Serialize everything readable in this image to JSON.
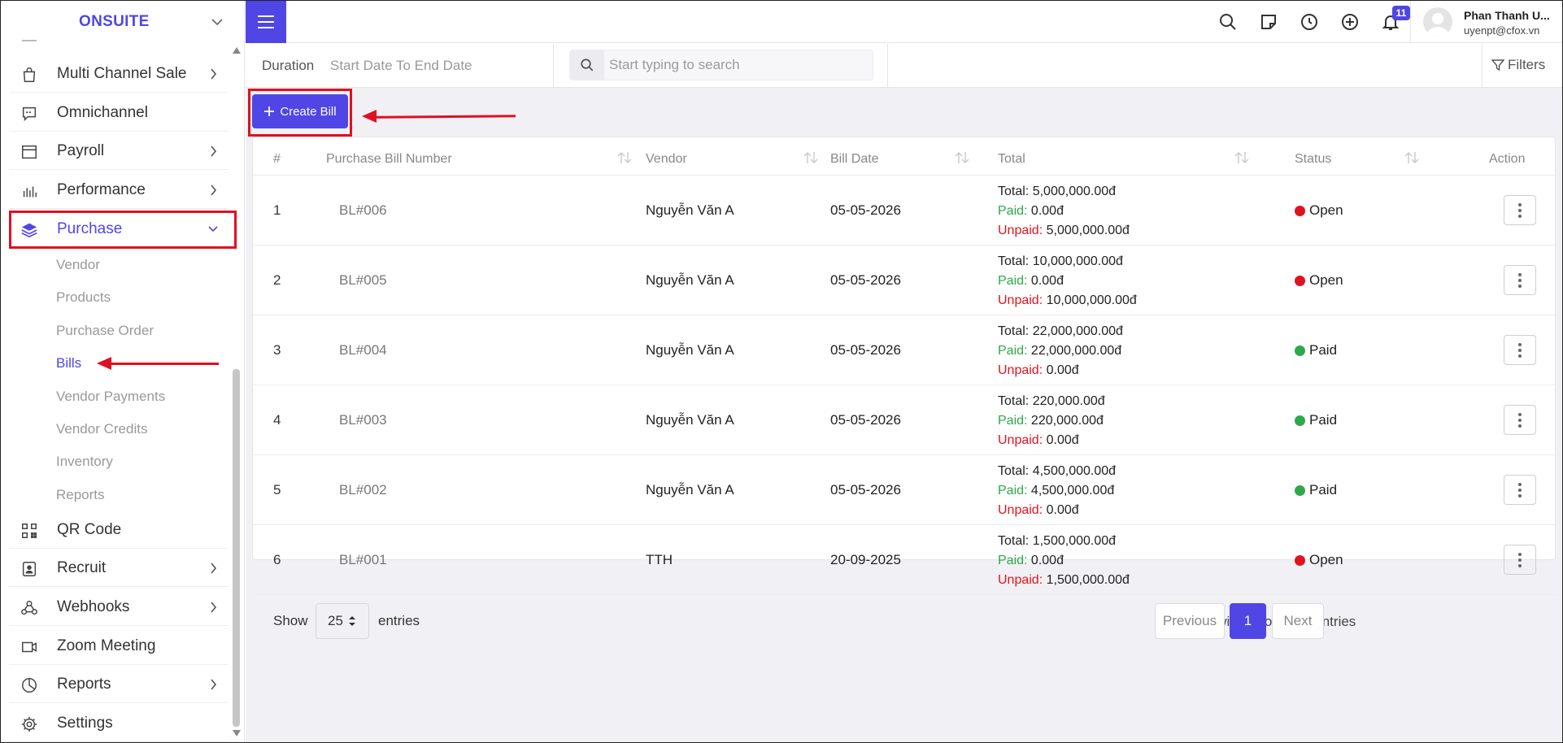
{
  "sidebar": {
    "brand": "ONSUITE",
    "menu": [
      {
        "label": "Multi Channel Sale",
        "icon": "shopping-bag-icon",
        "has_arrow": true
      },
      {
        "label": "Omnichannel",
        "icon": "chat-icon",
        "has_arrow": false
      },
      {
        "label": "Payroll",
        "icon": "payroll-icon",
        "has_arrow": true
      },
      {
        "label": "Performance",
        "icon": "bar-chart-icon",
        "has_arrow": true
      },
      {
        "label": "Purchase",
        "icon": "layers-icon",
        "has_arrow": true,
        "expanded": true
      }
    ],
    "submenu": [
      "Vendor",
      "Products",
      "Purchase Order",
      "Bills",
      "Vendor Payments",
      "Vendor Credits",
      "Inventory",
      "Reports"
    ],
    "active_submenu": "Bills",
    "menu2": [
      {
        "label": "QR Code",
        "icon": "qr-code-icon",
        "has_arrow": false
      },
      {
        "label": "Recruit",
        "icon": "badge-icon",
        "has_arrow": true
      },
      {
        "label": "Webhooks",
        "icon": "webhooks-icon",
        "has_arrow": true
      },
      {
        "label": "Zoom Meeting",
        "icon": "video-icon",
        "has_arrow": false
      },
      {
        "label": "Reports",
        "icon": "pie-chart-icon",
        "has_arrow": true
      },
      {
        "label": "Settings",
        "icon": "gear-icon",
        "has_arrow": false
      }
    ]
  },
  "topbar": {
    "notification_count": "11",
    "user_name": "Phan Thanh U...",
    "user_email": "uyenpt@cfox.vn"
  },
  "filterbar": {
    "duration_label": "Duration",
    "duration_value": "Start Date To End Date",
    "search_placeholder": "Start typing to search",
    "filters_label": "Filters"
  },
  "create_bill_label": "Create Bill",
  "table": {
    "headers": [
      "#",
      "Purchase Bill Number",
      "Vendor",
      "Bill Date",
      "Total",
      "Status",
      "Action"
    ],
    "total_label": "Total:",
    "paid_label": "Paid:",
    "unpaid_label": "Unpaid:",
    "rows": [
      {
        "num": "1",
        "bill": "BL#006",
        "vendor": "Nguyễn Văn A",
        "date": "05-05-2026",
        "total": "5,000,000.00đ",
        "paid": "0.00đ",
        "unpaid": "5,000,000.00đ",
        "status": "Open",
        "status_color": "#e0131f"
      },
      {
        "num": "2",
        "bill": "BL#005",
        "vendor": "Nguyễn Văn A",
        "date": "05-05-2026",
        "total": "10,000,000.00đ",
        "paid": "0.00đ",
        "unpaid": "10,000,000.00đ",
        "status": "Open",
        "status_color": "#e0131f"
      },
      {
        "num": "3",
        "bill": "BL#004",
        "vendor": "Nguyễn Văn A",
        "date": "05-05-2026",
        "total": "22,000,000.00đ",
        "paid": "22,000,000.00đ",
        "unpaid": "0.00đ",
        "status": "Paid",
        "status_color": "#2ea84a"
      },
      {
        "num": "4",
        "bill": "BL#003",
        "vendor": "Nguyễn Văn A",
        "date": "05-05-2026",
        "total": "220,000.00đ",
        "paid": "220,000.00đ",
        "unpaid": "0.00đ",
        "status": "Paid",
        "status_color": "#2ea84a"
      },
      {
        "num": "5",
        "bill": "BL#002",
        "vendor": "Nguyễn Văn A",
        "date": "05-05-2026",
        "total": "4,500,000.00đ",
        "paid": "4,500,000.00đ",
        "unpaid": "0.00đ",
        "status": "Paid",
        "status_color": "#2ea84a"
      },
      {
        "num": "6",
        "bill": "BL#001",
        "vendor": "TTH",
        "date": "20-09-2025",
        "total": "1,500,000.00đ",
        "paid": "0.00đ",
        "unpaid": "1,500,000.00đ",
        "status": "Open",
        "status_color": "#e0131f"
      }
    ]
  },
  "footer": {
    "show_label": "Show",
    "page_size": "25",
    "entries_label": "entries",
    "showing_text": "Showing 1 to 6 of 6 entries",
    "previous_label": "Previous",
    "current_page": "1",
    "next_label": "Next"
  },
  "colors": {
    "accent": "#4f46e5",
    "annotation": "#e01020",
    "open": "#e0131f",
    "paid": "#2ea84a"
  }
}
